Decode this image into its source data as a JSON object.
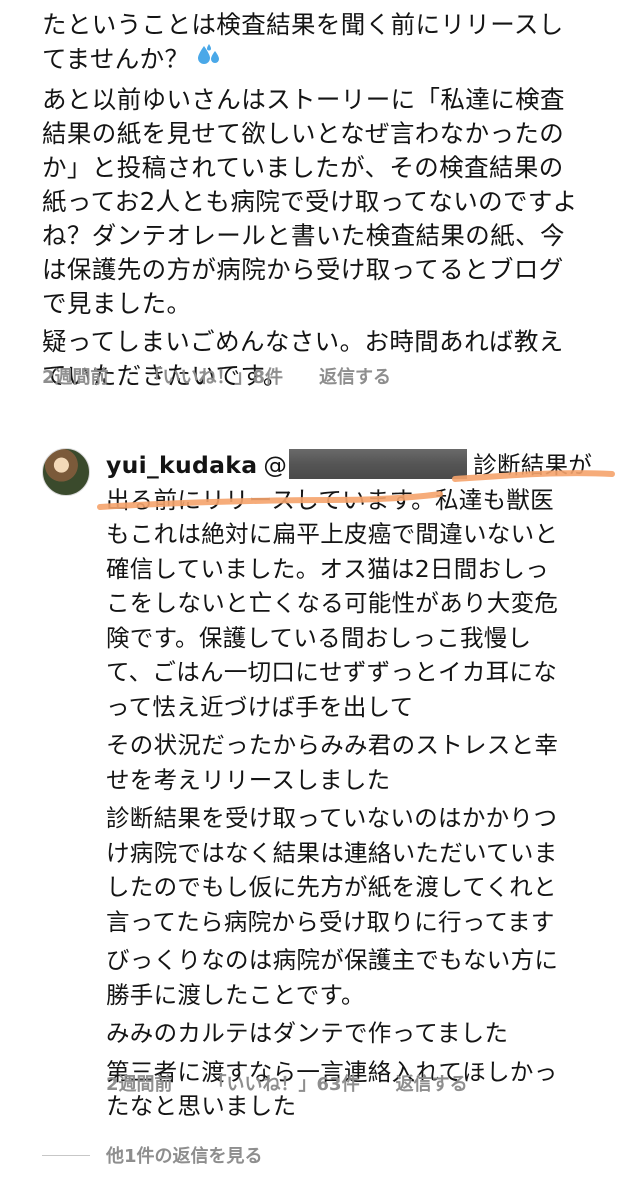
{
  "comment": {
    "paragraphs": [
      {
        "lines": [
          "たということは検査結果を聞く前にリリースし",
          "てませんか？"
        ],
        "trailing_icon": "sweat-droplets-icon"
      },
      {
        "lines": [
          "あと以前ゆいさんはストーリーに「私達に検査",
          "結果の紙を見せて欲しいとなぜ言わなかったの",
          "か」と投稿されていましたが、その検査結果の",
          "紙ってお2人とも病院で受け取ってないのですよ",
          "ね？ダンテオレールと書いた検査結果の紙、今",
          "は保護先の方が病院から受け取ってるとブログ",
          "で見ました。"
        ]
      },
      {
        "lines": [
          "疑ってしまいごめんなさい。お時間あれば教え",
          "ていただきたいです。"
        ]
      }
    ],
    "time": "2週間前",
    "likes": "「いいね！」8件",
    "reply_label": "返信する"
  },
  "reply": {
    "username": "yui_kudaka",
    "mention_prefix": "@",
    "first_line_tail": "診断結果が",
    "paragraphs": [
      {
        "lines": [
          "出る前にリリースしています。私達も獣医",
          "もこれは絶対に扁平上皮癌で間違いないと",
          "確信していました。オス猫は2日間おしっ",
          "こをしないと亡くなる可能性があり大変危",
          "険です。保護している間おしっこ我慢し",
          "て、ごはん一切口にせずずっとイカ耳にな",
          "って怯え近づけば手を出して"
        ]
      },
      {
        "lines": [
          "その状況だったからみみ君のストレスと幸",
          "せを考えリリースしました"
        ]
      },
      {
        "lines": [
          "診断結果を受け取っていないのはかかりつ",
          "け病院ではなく結果は連絡いただいていま",
          "したのでもし仮に先方が紙を渡してくれと",
          "言ってたら病院から受け取りに行ってます"
        ]
      },
      {
        "lines": [
          "びっくりなのは病院が保護主でもない方に",
          "勝手に渡したことです。"
        ]
      },
      {
        "lines": [
          "みみのカルテはダンテで作ってました"
        ]
      },
      {
        "lines": [
          "第三者に渡すなら一言連絡入れてほしかっ",
          "たなと思いました"
        ]
      }
    ],
    "time": "2週間前",
    "likes": "「いいね！」63件",
    "reply_label": "返信する",
    "highlight_color": "#f5a36b"
  },
  "view_more_replies": "他1件の返信を見る",
  "colors": {
    "text": "#141414",
    "secondary": "#8e8e8e",
    "redaction": "#555555"
  }
}
